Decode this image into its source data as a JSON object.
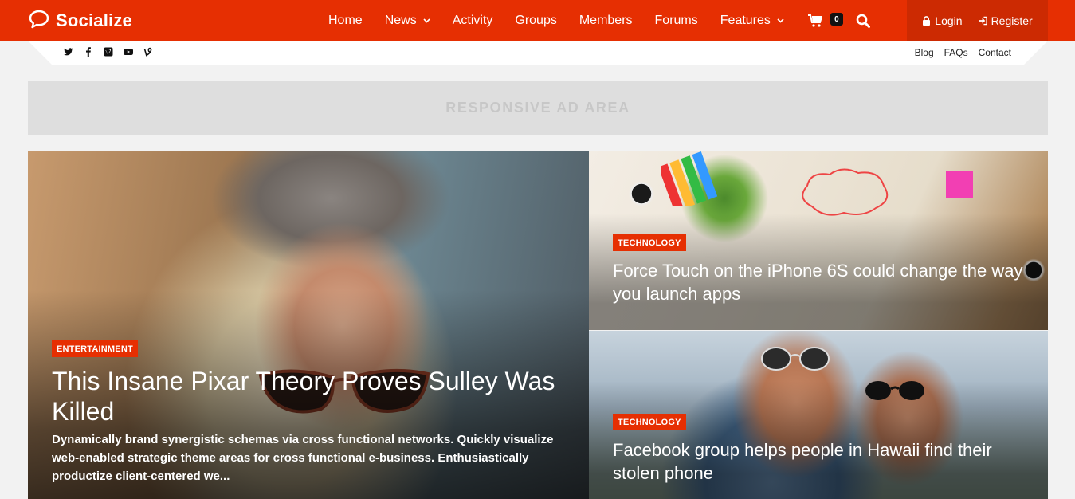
{
  "site": {
    "name": "Socialize"
  },
  "nav": {
    "items": [
      {
        "label": "Home",
        "dropdown": false
      },
      {
        "label": "News",
        "dropdown": true
      },
      {
        "label": "Activity",
        "dropdown": false
      },
      {
        "label": "Groups",
        "dropdown": false
      },
      {
        "label": "Members",
        "dropdown": false
      },
      {
        "label": "Forums",
        "dropdown": false
      },
      {
        "label": "Features",
        "dropdown": true
      }
    ],
    "cart_count": "0",
    "search_icon": "search-icon",
    "cart_icon": "cart-icon"
  },
  "auth": {
    "login": "Login",
    "register": "Register"
  },
  "social": [
    "twitter-icon",
    "facebook-icon",
    "vimeo-icon",
    "youtube-icon",
    "vine-icon"
  ],
  "top_links": [
    "Blog",
    "FAQs",
    "Contact"
  ],
  "ad": {
    "text": "RESPONSIVE AD AREA"
  },
  "featured": {
    "main": {
      "category": "ENTERTAINMENT",
      "title": "This Insane Pixar Theory Proves Sulley Was Killed",
      "excerpt": "Dynamically brand synergistic schemas via cross functional networks. Quickly visualize web-enabled strategic theme areas for cross functional e-business. Enthusiastically productize client-centered we..."
    },
    "side": [
      {
        "category": "TECHNOLOGY",
        "title": "Force Touch on the iPhone 6S could change the way you launch apps"
      },
      {
        "category": "TECHNOLOGY",
        "title": "Facebook group helps people in Hawaii find their stolen phone"
      }
    ]
  },
  "colors": {
    "brand": "#e62f02",
    "brand_dark": "#cc2a02",
    "background": "#f2f2f2",
    "ad_background": "#dedede"
  }
}
